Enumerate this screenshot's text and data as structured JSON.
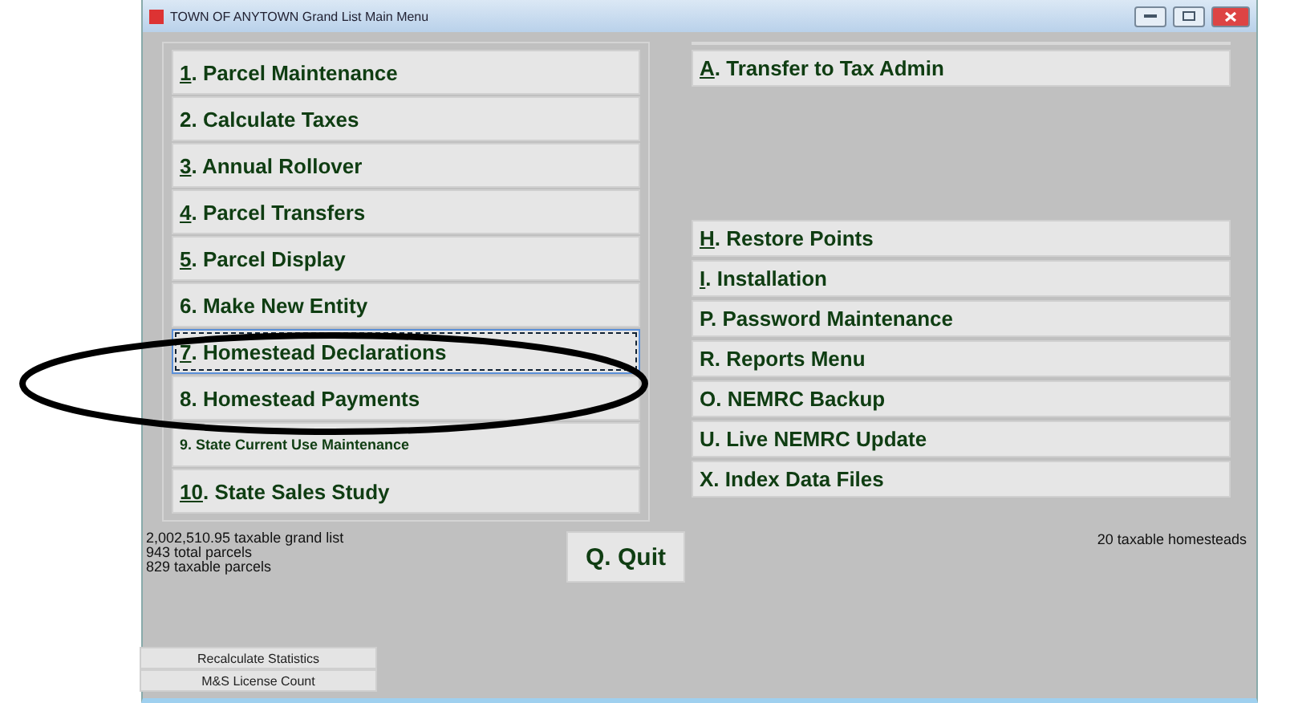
{
  "window": {
    "title": "TOWN OF ANYTOWN Grand List Main Menu"
  },
  "left_menu": [
    {
      "key": "1",
      "text": ".  Parcel Maintenance",
      "underlined": true,
      "selected": false,
      "kind": "large"
    },
    {
      "key": "2",
      "text": ".  Calculate Taxes",
      "underlined": false,
      "selected": false,
      "kind": "large"
    },
    {
      "key": "3",
      "text": ".  Annual Rollover",
      "underlined": true,
      "selected": false,
      "kind": "large"
    },
    {
      "key": "4",
      "text": ".  Parcel Transfers",
      "underlined": true,
      "selected": false,
      "kind": "large"
    },
    {
      "key": "5",
      "text": ".  Parcel Display",
      "underlined": true,
      "selected": false,
      "kind": "large"
    },
    {
      "key": "6",
      "text": ". Make New Entity",
      "underlined": false,
      "selected": false,
      "kind": "large"
    },
    {
      "key": "7",
      "text": ". Homestead Declarations",
      "underlined": true,
      "selected": true,
      "kind": "large"
    },
    {
      "key": "8",
      "text": ". Homestead Payments",
      "underlined": false,
      "selected": false,
      "kind": "large"
    },
    {
      "key": "9",
      "text": ". State Current Use Maintenance",
      "underlined": false,
      "selected": false,
      "kind": "small"
    },
    {
      "key": "10",
      "text": ". State Sales Study",
      "underlined": true,
      "selected": false,
      "kind": "large"
    }
  ],
  "right_top": [
    {
      "key": "A",
      "text": ". Transfer to Tax Admin",
      "underlined": true,
      "selected": false
    }
  ],
  "right_menu": [
    {
      "key": "H",
      "text": ". Restore Points",
      "underlined": true,
      "selected": false
    },
    {
      "key": "I",
      "text": ".  Installation",
      "underlined": true,
      "selected": false
    },
    {
      "key": "P",
      "text": ".  Password Maintenance",
      "underlined": false,
      "selected": false
    },
    {
      "key": "R",
      "text": ".  Reports Menu",
      "underlined": false,
      "selected": false
    },
    {
      "key": "O",
      "text": ". NEMRC Backup",
      "underlined": false,
      "selected": false
    },
    {
      "key": "U",
      "text": ". Live NEMRC Update",
      "underlined": false,
      "selected": false
    },
    {
      "key": "X",
      "text": ".  Index Data Files",
      "underlined": false,
      "selected": false
    }
  ],
  "stats": [
    "2,002,510.95 taxable grand list",
    "943 total parcels",
    "829 taxable parcels"
  ],
  "quit_button": "Q.  Quit",
  "homesteads": "20 taxable homesteads",
  "bottom_buttons": [
    "Recalculate Statistics",
    "M&S License Count"
  ]
}
